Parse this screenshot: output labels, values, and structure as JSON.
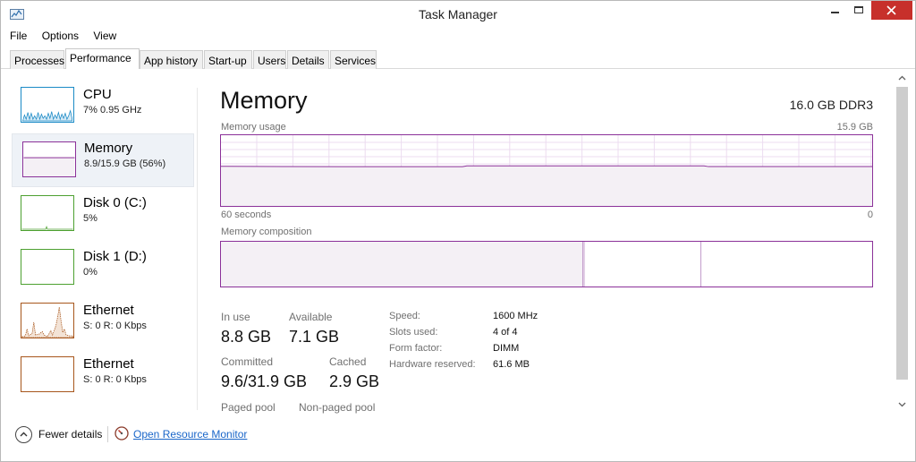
{
  "window": {
    "title": "Task Manager"
  },
  "menu": [
    "File",
    "Options",
    "View"
  ],
  "tabs": [
    "Processes",
    "Performance",
    "App history",
    "Start-up",
    "Users",
    "Details",
    "Services"
  ],
  "active_tab": "Performance",
  "sidebar": {
    "items": [
      {
        "name": "CPU",
        "sub": "7% 0.95 GHz",
        "color": "#1a8ac6"
      },
      {
        "name": "Memory",
        "sub": "8.9/15.9 GB (56%)",
        "color": "#8b3199"
      },
      {
        "name": "Disk 0 (C:)",
        "sub": "5%",
        "color": "#4da030"
      },
      {
        "name": "Disk 1 (D:)",
        "sub": "0%",
        "color": "#4da030"
      },
      {
        "name": "Ethernet",
        "sub": "S: 0 R: 0 Kbps",
        "color": "#a7561c"
      },
      {
        "name": "Ethernet",
        "sub": "S: 0 R: 0 Kbps",
        "color": "#a7561c"
      }
    ],
    "selected": "Memory"
  },
  "main": {
    "title": "Memory",
    "spec": "16.0 GB DDR3",
    "usage_label": "Memory usage",
    "usage_max": "15.9 GB",
    "time_left": "60 seconds",
    "time_right": "0",
    "composition_label": "Memory composition",
    "usage_fraction": 0.56,
    "composition": {
      "in_use_fraction": 0.556,
      "modified_fraction": 0.003,
      "standby_fraction": 0.178
    },
    "stats": {
      "in_use_label": "In use",
      "in_use_value": "8.8 GB",
      "available_label": "Available",
      "available_value": "7.1 GB",
      "committed_label": "Committed",
      "committed_value": "9.6/31.9 GB",
      "cached_label": "Cached",
      "cached_value": "2.9 GB",
      "paged_label": "Paged pool",
      "nonpaged_label": "Non-paged pool"
    },
    "details": [
      {
        "label": "Speed:",
        "value": "1600 MHz"
      },
      {
        "label": "Slots used:",
        "value": "4 of 4"
      },
      {
        "label": "Form factor:",
        "value": "DIMM"
      },
      {
        "label": "Hardware reserved:",
        "value": "61.6 MB"
      }
    ]
  },
  "footer": {
    "fewer_details": "Fewer details",
    "resource_monitor": "Open Resource Monitor"
  },
  "colors": {
    "accent_memory": "#8b3199",
    "memory_fill": "#f4f0f5",
    "close_button": "#c7302b",
    "link": "#1a66c9"
  },
  "icons": [
    "task-manager-icon",
    "minimize-icon",
    "maximize-icon",
    "close-icon",
    "chevron-up-icon",
    "resource-monitor-icon",
    "scroll-up-arrow-icon",
    "scroll-down-arrow-icon"
  ]
}
